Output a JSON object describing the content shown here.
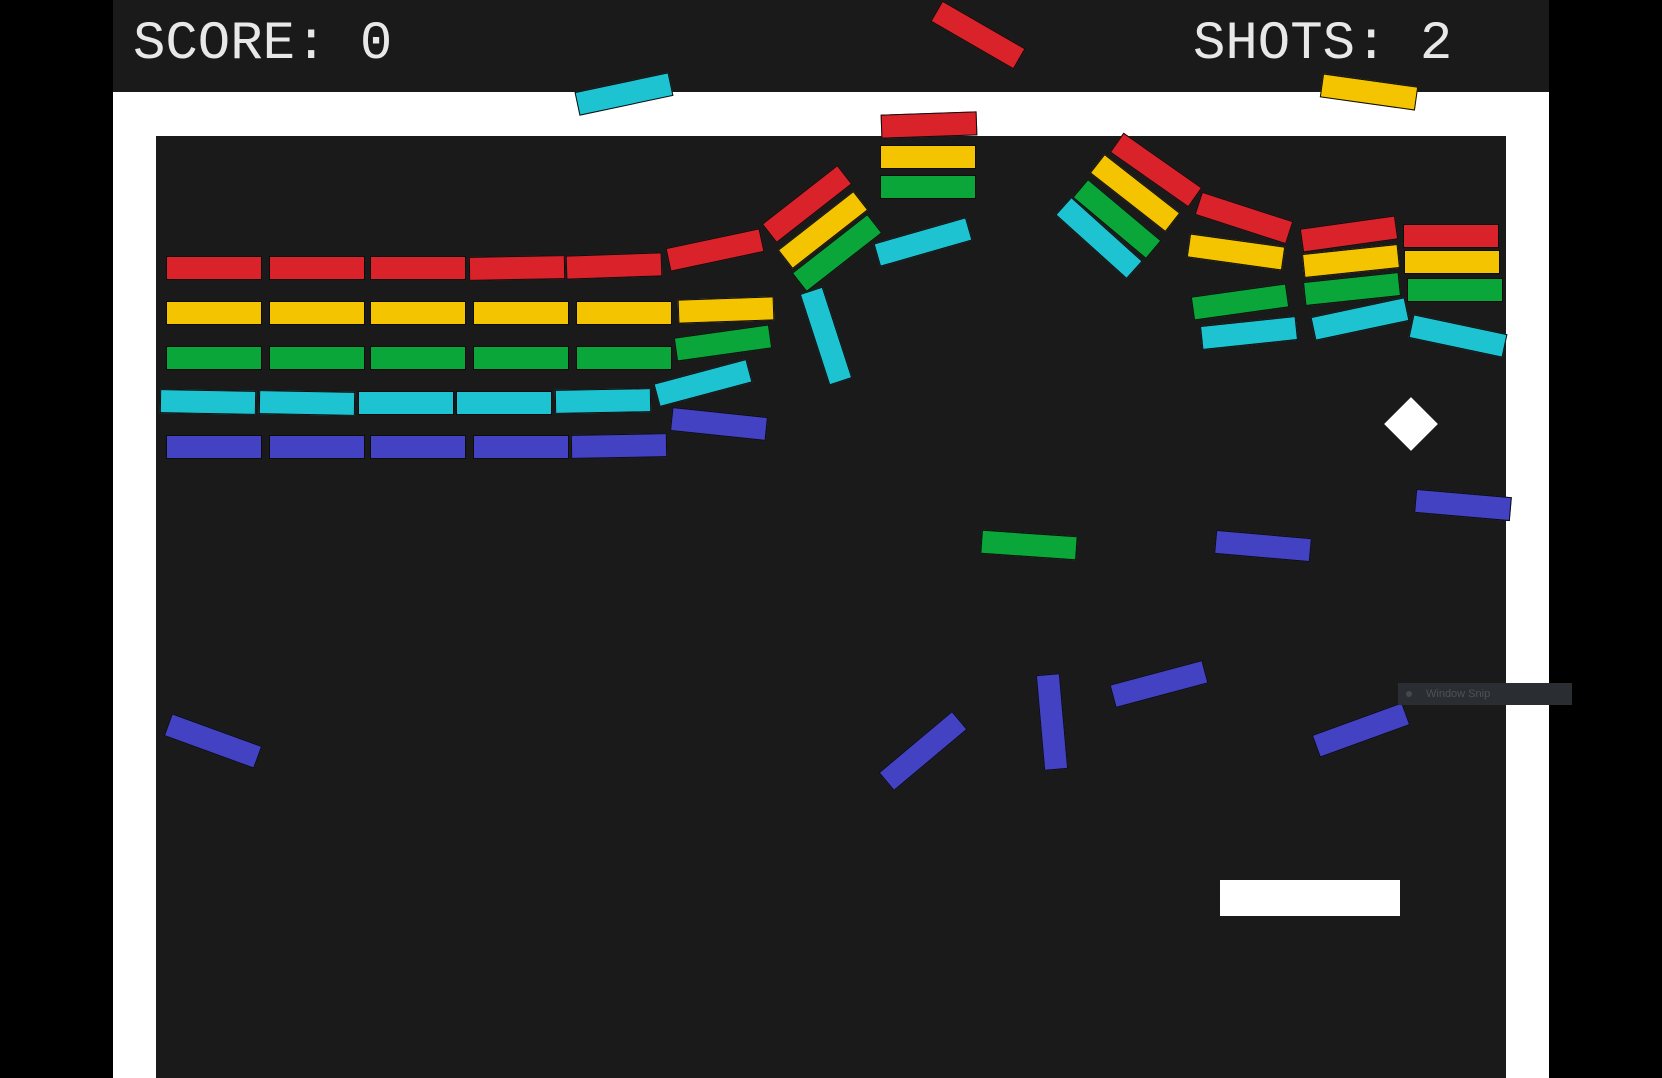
{
  "hud": {
    "score_text": "SCORE: 0",
    "shots_text": "SHOTS: 2",
    "score": 0,
    "shots": 2
  },
  "colors": {
    "red": "#d9222a",
    "yellow": "#f5c400",
    "green": "#0aa63a",
    "cyan": "#1ec3d2",
    "blue": "#4242c2",
    "background": "#1a1a1a",
    "walls": "#ffffff"
  },
  "bricks": [
    {
      "color": "red"
    },
    {
      "color": "red"
    },
    {
      "color": "red"
    },
    {
      "color": "red"
    },
    {
      "color": "red"
    },
    {
      "color": "yellow"
    },
    {
      "color": "yellow"
    },
    {
      "color": "yellow"
    },
    {
      "color": "yellow"
    },
    {
      "color": "yellow"
    },
    {
      "color": "green"
    },
    {
      "color": "green"
    },
    {
      "color": "green"
    },
    {
      "color": "green"
    },
    {
      "color": "green"
    },
    {
      "color": "cyan"
    },
    {
      "color": "cyan"
    },
    {
      "color": "cyan"
    },
    {
      "color": "cyan"
    },
    {
      "color": "cyan"
    },
    {
      "color": "blue"
    },
    {
      "color": "blue"
    },
    {
      "color": "blue"
    },
    {
      "color": "blue"
    },
    {
      "color": "blue"
    },
    {
      "color": "red"
    },
    {
      "color": "yellow"
    },
    {
      "color": "green"
    },
    {
      "color": "cyan"
    },
    {
      "color": "blue"
    },
    {
      "color": "red"
    },
    {
      "color": "yellow"
    },
    {
      "color": "green"
    },
    {
      "color": "cyan"
    },
    {
      "color": "red"
    },
    {
      "color": "yellow"
    },
    {
      "color": "green"
    },
    {
      "color": "cyan"
    },
    {
      "color": "red"
    },
    {
      "color": "yellow"
    },
    {
      "color": "green"
    },
    {
      "color": "cyan"
    },
    {
      "color": "red"
    },
    {
      "color": "yellow"
    },
    {
      "color": "green"
    },
    {
      "color": "cyan"
    },
    {
      "color": "red"
    },
    {
      "color": "yellow"
    },
    {
      "color": "green"
    },
    {
      "color": "cyan"
    },
    {
      "color": "red"
    },
    {
      "color": "yellow"
    },
    {
      "color": "green"
    },
    {
      "color": "cyan"
    },
    {
      "color": "red"
    },
    {
      "color": "cyan"
    },
    {
      "color": "yellow"
    },
    {
      "color": "green"
    },
    {
      "color": "blue"
    },
    {
      "color": "blue"
    },
    {
      "color": "blue"
    },
    {
      "color": "blue"
    },
    {
      "color": "blue"
    },
    {
      "color": "blue"
    },
    {
      "color": "blue"
    }
  ],
  "overlay": {
    "snip_label": "Window Snip"
  }
}
